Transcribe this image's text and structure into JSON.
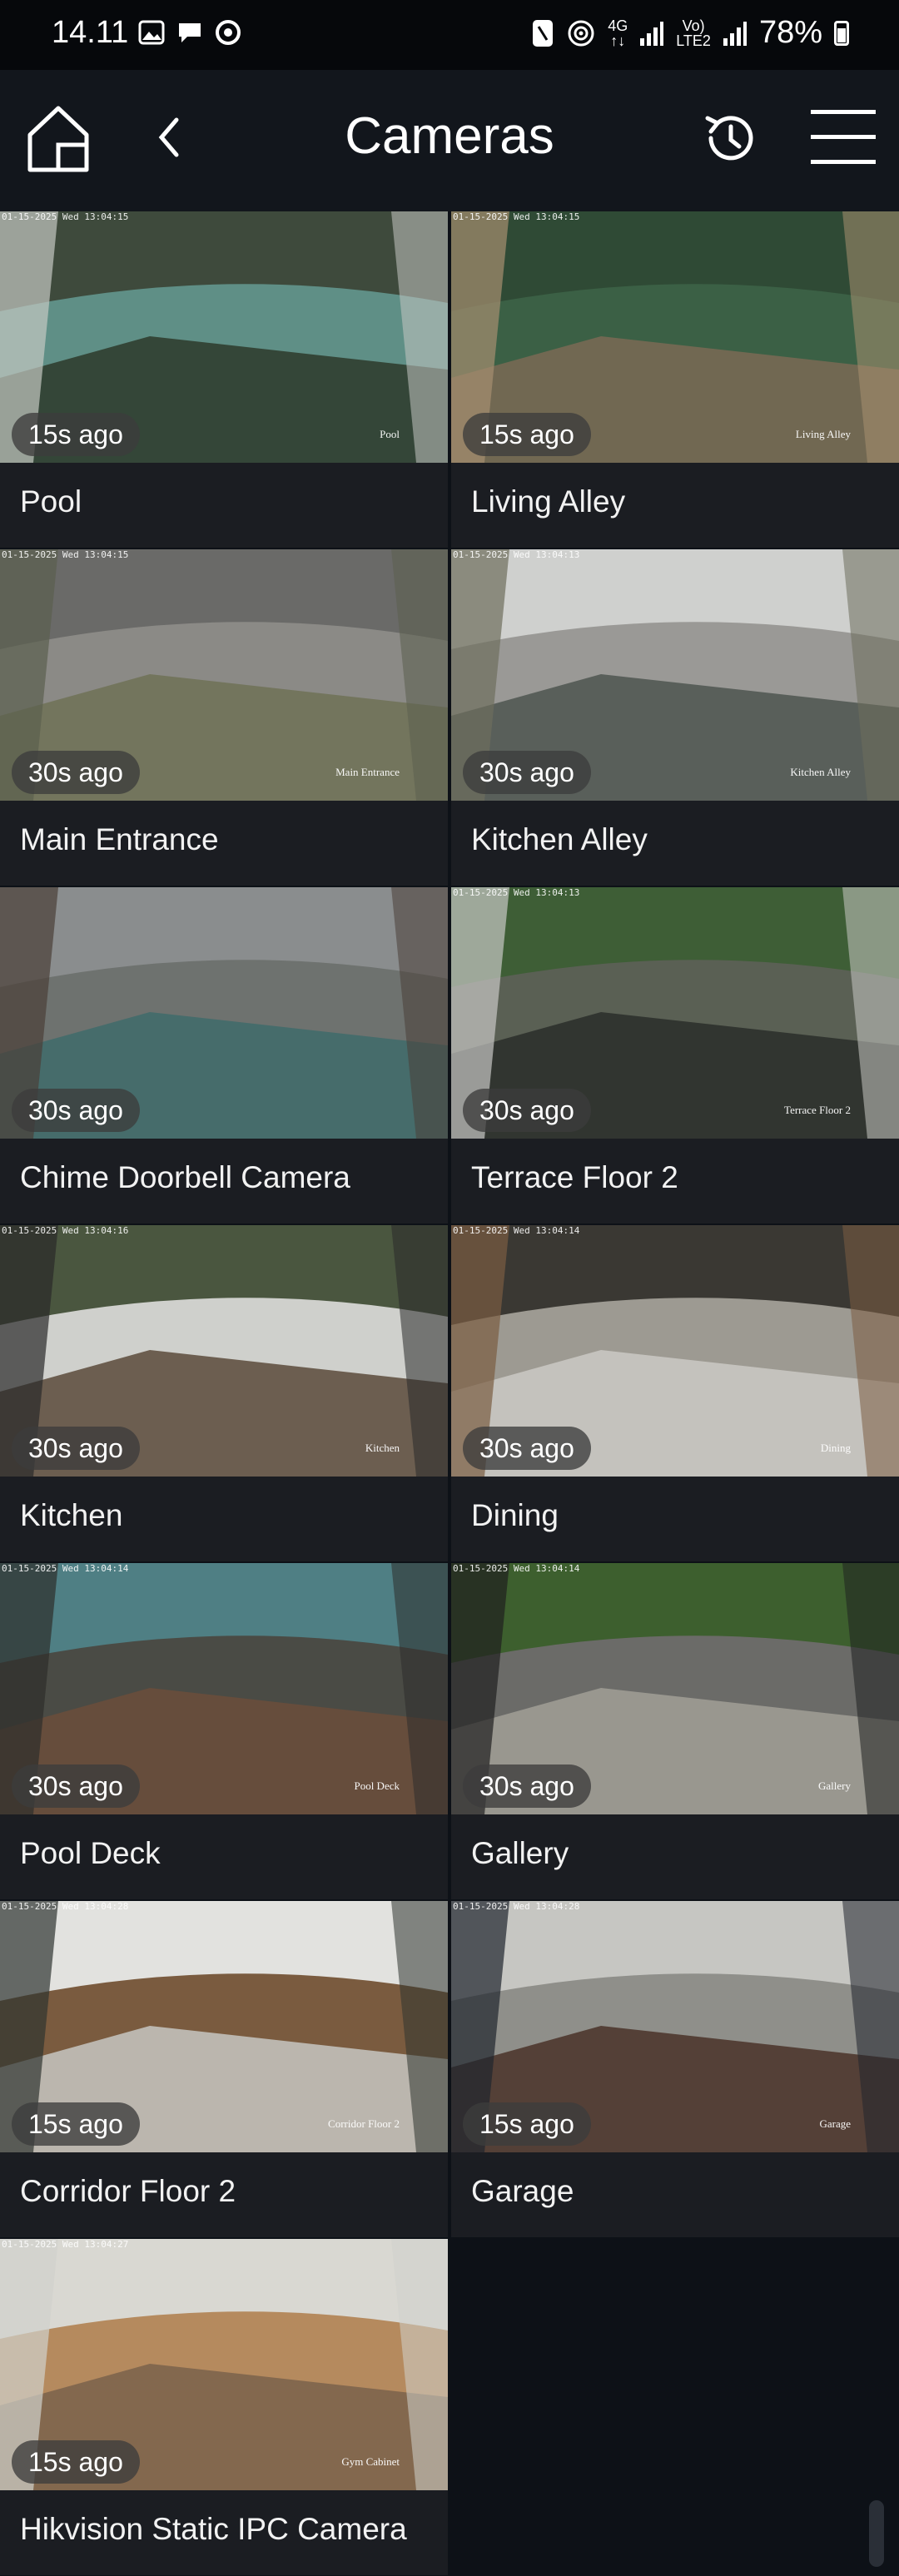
{
  "status": {
    "time": "14.11",
    "battery": "78%",
    "net_top": "4G",
    "volte_top": "Vo)",
    "volte_bottom": "LTE2"
  },
  "header": {
    "title": "Cameras"
  },
  "cameras": [
    {
      "name": "Pool",
      "ago": "15s ago",
      "timestamp": "01-15-2025 Wed 13:04:15",
      "overlay": "Pool"
    },
    {
      "name": "Living Alley",
      "ago": "15s ago",
      "timestamp": "01-15-2025 Wed 13:04:15",
      "overlay": "Living Alley"
    },
    {
      "name": "Main Entrance",
      "ago": "30s ago",
      "timestamp": "01-15-2025 Wed 13:04:15",
      "overlay": "Main Entrance"
    },
    {
      "name": "Kitchen Alley",
      "ago": "30s ago",
      "timestamp": "01-15-2025 Wed 13:04:13",
      "overlay": "Kitchen Alley"
    },
    {
      "name": "Chime Doorbell Camera",
      "ago": "30s ago",
      "timestamp": "",
      "overlay": ""
    },
    {
      "name": "Terrace Floor 2",
      "ago": "30s ago",
      "timestamp": "01-15-2025 Wed 13:04:13",
      "overlay": "Terrace Floor 2"
    },
    {
      "name": "Kitchen",
      "ago": "30s ago",
      "timestamp": "01-15-2025 Wed 13:04:16",
      "overlay": "Kitchen"
    },
    {
      "name": "Dining",
      "ago": "30s ago",
      "timestamp": "01-15-2025 Wed 13:04:14",
      "overlay": "Dining"
    },
    {
      "name": "Pool Deck",
      "ago": "30s ago",
      "timestamp": "01-15-2025 Wed 13:04:14",
      "overlay": "Pool Deck"
    },
    {
      "name": "Gallery",
      "ago": "30s ago",
      "timestamp": "01-15-2025 Wed 13:04:14",
      "overlay": "Gallery"
    },
    {
      "name": "Corridor Floor 2",
      "ago": "15s ago",
      "timestamp": "01-15-2025 Wed 13:04:28",
      "overlay": "Corridor Floor 2"
    },
    {
      "name": "Garage",
      "ago": "15s ago",
      "timestamp": "01-15-2025 Wed 13:04:28",
      "overlay": "Garage"
    },
    {
      "name": "Hikvision Static IPC Camera",
      "ago": "15s ago",
      "timestamp": "01-15-2025 Wed 13:04:27",
      "overlay": "Gym Cabinet"
    }
  ],
  "colors": {
    "background": "#0d1117",
    "appbar": "#12161c",
    "tile_label_bg": "#1b1d22"
  }
}
